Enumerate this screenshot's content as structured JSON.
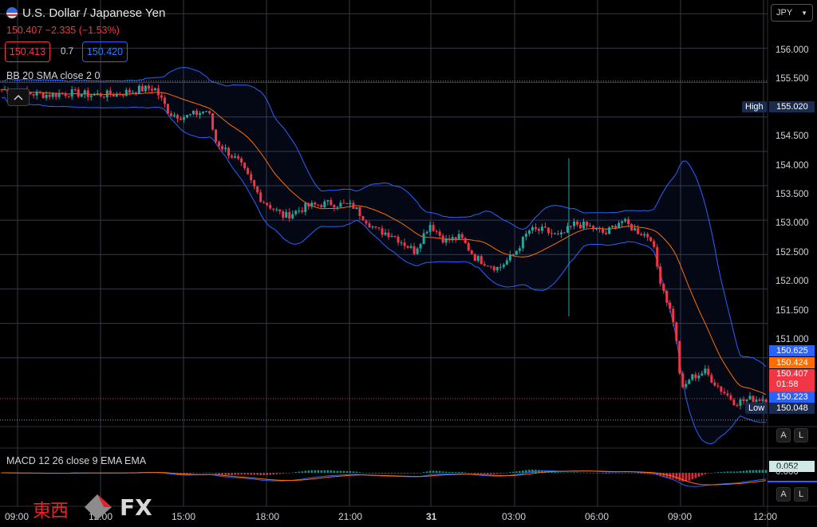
{
  "header": {
    "title": "U.S. Dollar / Japanese Yen",
    "price_line": "150.407  −2.335 (−1.53%)",
    "bid": "150.413",
    "spread": "0.7",
    "ask": "150.420",
    "currency": "JPY"
  },
  "indicators": {
    "bb": "BB 20 SMA close 2 0",
    "macd": "MACD 12 26 close 9 EMA EMA"
  },
  "price_axis": {
    "ticks": [
      "156.000",
      "155.500",
      "155.000",
      "154.500",
      "154.000",
      "153.500",
      "153.000",
      "152.500",
      "152.000",
      "151.500",
      "151.000"
    ],
    "high_label": "High",
    "high_value": "155.020",
    "low_label": "Low",
    "low_value": "150.048",
    "bb_upper": "150.625",
    "bb_basis": "150.424",
    "last_price": "150.407",
    "countdown": "01:58",
    "bb_lower": "150.223",
    "auto_btn": "A",
    "log_btn": "L"
  },
  "macd_axis": {
    "value": "0.052",
    "zero": "0.000",
    "auto_btn": "A",
    "log_btn": "L"
  },
  "time_axis": [
    "09:00",
    "12:00",
    "15:00",
    "18:00",
    "21:00",
    "31",
    "03:00",
    "06:00",
    "09:00",
    "12:00"
  ],
  "watermark": {
    "cjk": "東西",
    "fx": "FX"
  },
  "colors": {
    "up": "#26a69a",
    "down": "#f23645",
    "bb_band": "#2962ff",
    "bb_basis": "#ff6d00",
    "macd_line": "#2962ff",
    "signal_line": "#ff6d00",
    "grid": "#363a45"
  },
  "chart_data": {
    "type": "candlestick",
    "symbol": "USD/JPY",
    "x": [
      "09:00",
      "12:00",
      "15:00",
      "18:00",
      "21:00",
      "31",
      "03:00",
      "06:00",
      "09:00",
      "12:00"
    ],
    "ylim": [
      150.0,
      156.2
    ],
    "close_path": [
      [
        0,
        154.9
      ],
      [
        0.03,
        154.85
      ],
      [
        0.06,
        154.82
      ],
      [
        0.09,
        154.85
      ],
      [
        0.12,
        154.82
      ],
      [
        0.15,
        154.83
      ],
      [
        0.18,
        154.9
      ],
      [
        0.2,
        154.92
      ],
      [
        0.22,
        154.55
      ],
      [
        0.24,
        154.5
      ],
      [
        0.27,
        154.6
      ],
      [
        0.28,
        154.15
      ],
      [
        0.31,
        153.85
      ],
      [
        0.34,
        153.3
      ],
      [
        0.37,
        153.05
      ],
      [
        0.4,
        153.2
      ],
      [
        0.43,
        153.25
      ],
      [
        0.46,
        153.2
      ],
      [
        0.49,
        152.85
      ],
      [
        0.51,
        152.8
      ],
      [
        0.54,
        152.55
      ],
      [
        0.56,
        152.95
      ],
      [
        0.58,
        152.7
      ],
      [
        0.6,
        152.75
      ],
      [
        0.62,
        152.45
      ],
      [
        0.65,
        152.3
      ],
      [
        0.67,
        152.5
      ],
      [
        0.69,
        152.85
      ],
      [
        0.71,
        152.85
      ],
      [
        0.73,
        152.75
      ],
      [
        0.75,
        152.95
      ],
      [
        0.77,
        152.9
      ],
      [
        0.79,
        152.8
      ],
      [
        0.81,
        153.0
      ],
      [
        0.83,
        152.85
      ],
      [
        0.85,
        152.75
      ],
      [
        0.86,
        152.2
      ],
      [
        0.88,
        151.5
      ],
      [
        0.89,
        150.5
      ],
      [
        0.9,
        150.7
      ],
      [
        0.92,
        150.8
      ],
      [
        0.94,
        150.55
      ],
      [
        0.96,
        150.35
      ],
      [
        0.98,
        150.4
      ],
      [
        1.0,
        150.41
      ]
    ],
    "high": 155.02,
    "low": 150.048,
    "last": 150.407,
    "bb_upper_last": 150.625,
    "bb_basis_last": 150.424,
    "bb_lower_last": 150.223,
    "macd_hist_last": 0.052
  }
}
